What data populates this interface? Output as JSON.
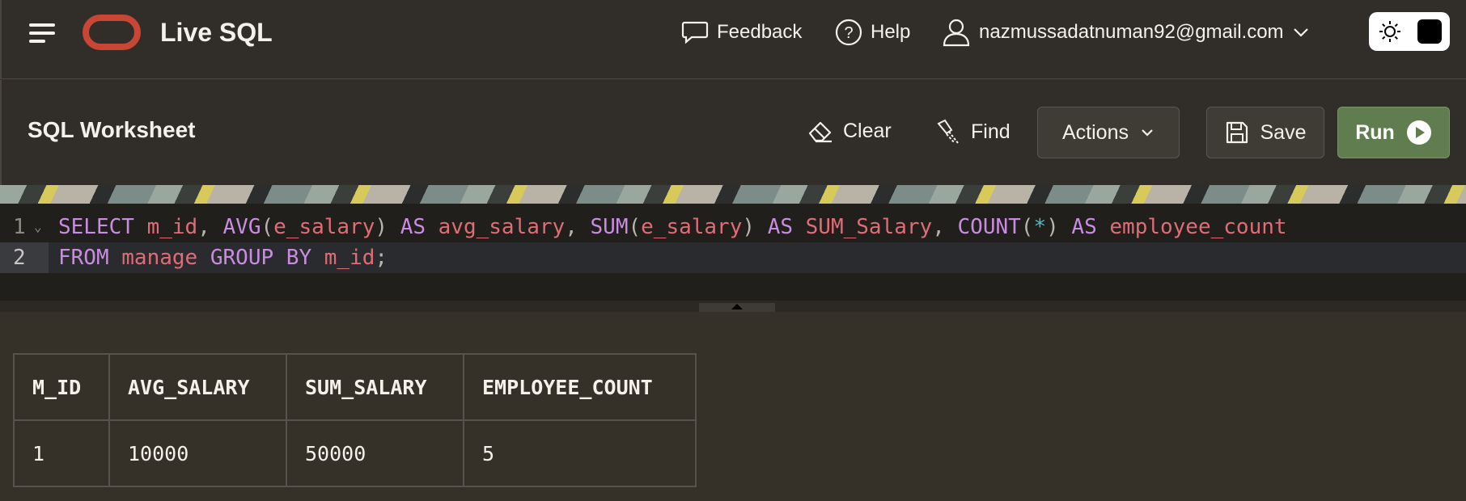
{
  "header": {
    "app_title": "Live SQL",
    "feedback_label": "Feedback",
    "help_label": "Help",
    "user_email": "nazmussadatnuman92@gmail.com"
  },
  "toolbar": {
    "title": "SQL Worksheet",
    "clear_label": "Clear",
    "find_label": "Find",
    "actions_label": "Actions",
    "save_label": "Save",
    "run_label": "Run"
  },
  "editor": {
    "lines": [
      {
        "number": "1",
        "text": "SELECT m_id, AVG(e_salary) AS avg_salary, SUM(e_salary) AS SUM_Salary, COUNT(*) AS employee_count"
      },
      {
        "number": "2",
        "text": "FROM manage GROUP BY m_id;"
      }
    ]
  },
  "results": {
    "columns": [
      "M_ID",
      "AVG_SALARY",
      "SUM_SALARY",
      "EMPLOYEE_COUNT"
    ],
    "rows": [
      [
        "1",
        "10000",
        "50000",
        "5"
      ]
    ]
  },
  "colors": {
    "run_button": "#5f7d4f",
    "logo": "#c74634",
    "keyword": "#c98ce0",
    "identifier": "#e06c75"
  }
}
